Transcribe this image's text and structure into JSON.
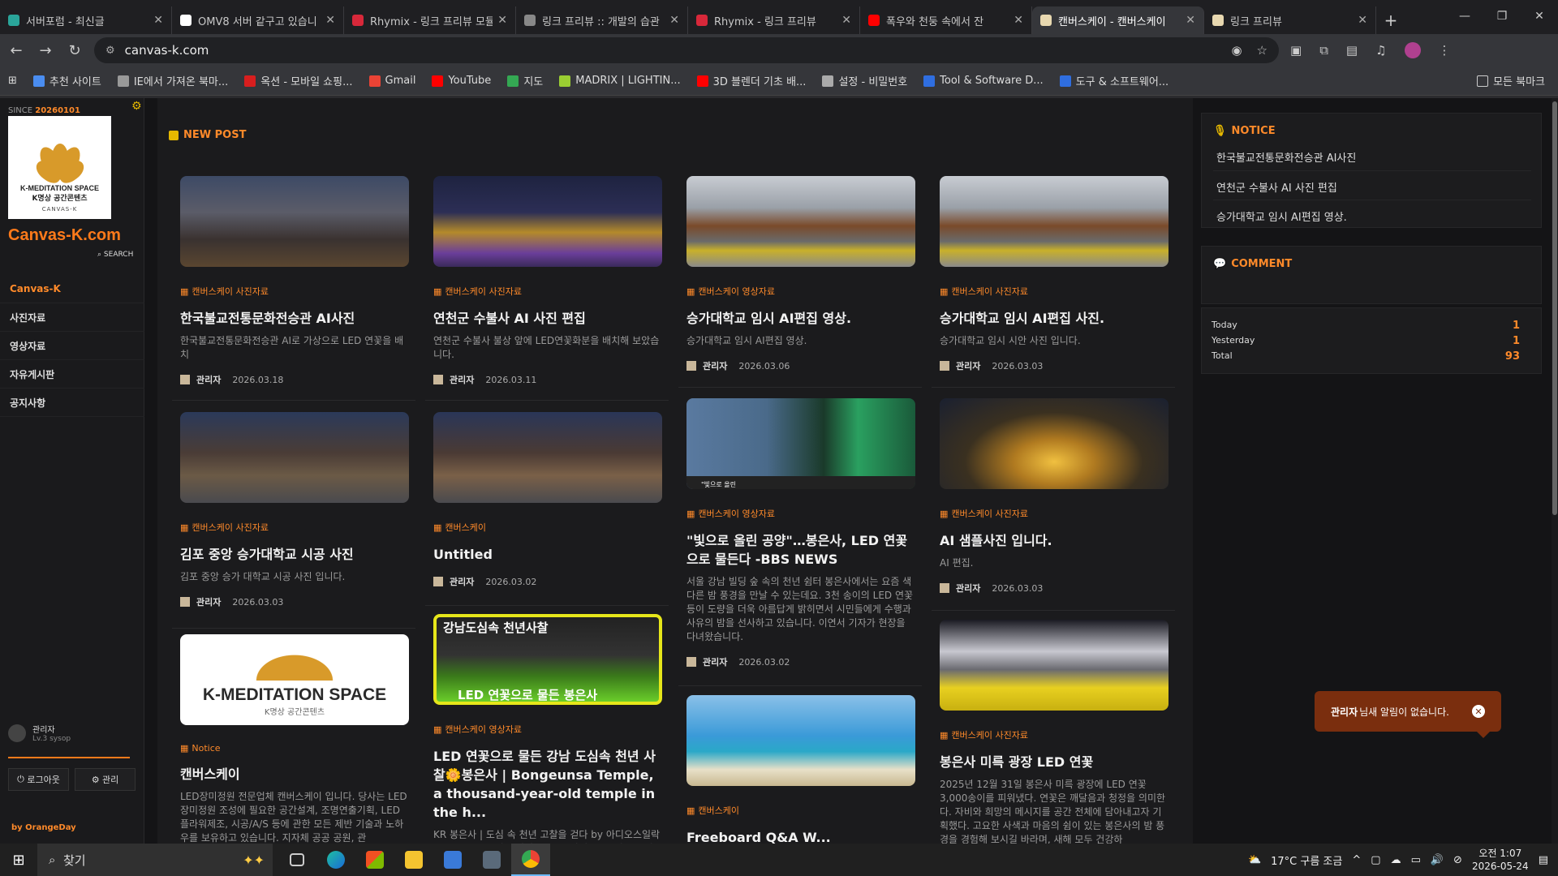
{
  "browser": {
    "tabs": [
      {
        "title": "서버포럼 - 최신글",
        "color": "#2aa59a",
        "active": false
      },
      {
        "title": "OMV8 서버 같구고 있습니",
        "color": "#ffffff",
        "active": false
      },
      {
        "title": "Rhymix - 링크 프리뷰 모듈",
        "color": "#d8283a",
        "active": false
      },
      {
        "title": "링크 프리뷰 :: 개발의 습관",
        "color": "#888888",
        "active": false
      },
      {
        "title": "Rhymix - 링크 프리뷰",
        "color": "#d8283a",
        "active": false
      },
      {
        "title": "폭우와 천둥 속에서 잔",
        "color": "#ff0000",
        "active": false
      },
      {
        "title": "캔버스케이 - 캔버스케이",
        "color": "#e8d8b0",
        "active": true
      },
      {
        "title": "링크 프리뷰",
        "color": "#e8d8b0",
        "active": false
      }
    ],
    "url": "canvas-k.com",
    "bookmarks": [
      {
        "label": "추천 사이트",
        "color": "#4a8df0"
      },
      {
        "label": "IE에서 가져온 북마...",
        "color": "#999999"
      },
      {
        "label": "옥션 - 모바일 쇼핑...",
        "color": "#d81e1e"
      },
      {
        "label": "Gmail",
        "color": "#ea4335"
      },
      {
        "label": "YouTube",
        "color": "#ff0000"
      },
      {
        "label": "지도",
        "color": "#34a853"
      },
      {
        "label": "MADRIX | LIGHTIN...",
        "color": "#9acd32"
      },
      {
        "label": "3D 블렌더 기초 배...",
        "color": "#ff0000"
      },
      {
        "label": "설정 - 비밀번호",
        "color": "#aaaaaa"
      },
      {
        "label": "Tool & Software D...",
        "color": "#2f6ee0"
      },
      {
        "label": "도구 & 소프트웨어...",
        "color": "#2f6ee0"
      }
    ],
    "all_bookmarks": "모든 북마크"
  },
  "sidebar": {
    "since_label": "SINCE",
    "since_date": "20260101",
    "logo_line1": "K-MEDITATION SPACE",
    "logo_line2": "K명상 공간콘텐츠",
    "logo_line3": "CANVAS-K",
    "site_name": "Canvas-K.com",
    "search_label": "SEARCH",
    "menu": [
      "Canvas-K",
      "사진자료",
      "영상자료",
      "자유게시판",
      "공지사항"
    ],
    "user_name": "관리자",
    "user_level": "Lv.3",
    "user_id": "sysop",
    "logout_label": "로그아웃",
    "admin_label": "관리",
    "credit": "by OrangeDay"
  },
  "main": {
    "new_post_label": "NEW POST",
    "posts": [
      {
        "category": "캔버스케이 사진자료",
        "title": "한국불교전통문화전승관 AI사진",
        "desc": "한국불교전통문화전승관 AI로 가상으로 LED 연꽃을 배치",
        "author": "관리자",
        "date": "2026.03.18"
      },
      {
        "category": "캔버스케이 사진자료",
        "title": "연천군 수불사 AI 사진 편집",
        "desc": "연천군 수불사 불상 앞에 LED연꽃화분을 배치해 보았습니다.",
        "author": "관리자",
        "date": "2026.03.11"
      },
      {
        "category": "캔버스케이 영상자료",
        "title": "승가대학교 임시 AI편집 영상.",
        "desc": "승가대학교 임시 AI편집 영상.",
        "author": "관리자",
        "date": "2026.03.06"
      },
      {
        "category": "캔버스케이 사진자료",
        "title": "승가대학교 임시 AI편집 사진.",
        "desc": "승가대학교 임시 시안 사진 입니다.",
        "author": "관리자",
        "date": "2026.03.03"
      },
      {
        "category": "캔버스케이 사진자료",
        "title": "김포 중앙 승가대학교 시공 사진",
        "desc": "김포 중앙 승가 대학교 시공 사진 입니다.",
        "author": "관리자",
        "date": "2026.03.03"
      },
      {
        "category": "캔버스케이",
        "title": "Untitled",
        "desc": "",
        "author": "관리자",
        "date": "2026.03.02"
      },
      {
        "category": "캔버스케이 영상자료",
        "title": "\"빛으로 올린 공양\"…봉은사, LED 연꽃으로 물든다 -BBS NEWS",
        "desc": "서울 강남 빌딩 숲 속의 천년 쉼터 봉은사에서는 요즘 색다른 밤 풍경을 만날 수 있는데요. 3천 송이의 LED 연꽃등이 도량을 더욱 아름답게 밝히면서 시민들에게 수행과 사유의 밤을 선사하고 있습니다. 이연서 기자가 현장을 다녀왔습니다.",
        "author": "관리자",
        "date": "2026.03.02"
      },
      {
        "category": "캔버스케이 사진자료",
        "title": "AI 샘플사진 입니다.",
        "desc": "AI 편집.",
        "author": "관리자",
        "date": "2026.03.03"
      },
      {
        "category": "Notice",
        "title": "캔버스케이",
        "desc": "LED장미정원 전문업체 캔버스케이 입니다. 당사는 LED장미정원 조성에 필요한 공간설계, 조명연출기획, LED플라워제조, 시공/A/S 등에 관한 모든 제반 기술과 노하우를 보유하고 있습니다. 지자체 공공 공원, 관",
        "author": "",
        "date": ""
      },
      {
        "category": "캔버스케이 영상자료",
        "title": "LED 연꽃으로 물든 강남 도심속 천년 사찰🌼봉은사 | Bongeunsa Temple, a thousand-year-old temple in the h...",
        "desc": "KR 봉은사 | 도심 속 천년 고찰을 걷다 by 아디오스일락 (Adios Ilrak) 서울 강남 한복판, 삼성중앙역과 봉은사역 사이에 위치한 봉은사는 천 년의 역사를 간직",
        "author": "",
        "date": ""
      },
      {
        "category": "캔버스케이",
        "title": "Freeboard Q&A W...",
        "desc": "",
        "author": "",
        "date": ""
      },
      {
        "category": "캔버스케이 사진자료",
        "title": "봉은사 미륵 광장 LED 연꽃",
        "desc": "2025년 12월 31일 봉은사 미륵 광장에 LED 연꽃 3,000송이를 피워냈다. 연꽃은 깨달음과 청정을 의미한다. 자비와 희망의 메시지를 공간 전체에 담아내고자 기획했다. 고요한 사색과 마음의 쉼이 있는 봉은사의 밤 풍경을 경험해 보시길 바라며, 새해 모두 건강하",
        "author": "",
        "date": ""
      }
    ],
    "thumb_banner_text": "강남도심속 천년사찰",
    "thumb_banner_text2": "LED 연꽃으로 물든 봉은사",
    "thumb_logo_text": "K-MEDITATION SPACE",
    "thumb_logo_sub": "K명상 공간콘텐츠",
    "thumb_bbs": "\"빛으로 올린"
  },
  "right": {
    "notice_label": "NOTICE",
    "notices": [
      "한국불교전통문화전승관 AI사진",
      "연천군 수불사 AI 사진 편집",
      "승가대학교 임시 AI편집 영상."
    ],
    "comment_label": "COMMENT",
    "stats": [
      {
        "label": "Today",
        "value": "1"
      },
      {
        "label": "Yesterday",
        "value": "1"
      },
      {
        "label": "Total",
        "value": "93"
      }
    ]
  },
  "toast": {
    "user": "관리자",
    "message": "님새 알림이 없습니다."
  },
  "taskbar": {
    "search_placeholder": "찾기",
    "weather": "17°C 구름 조금",
    "time": "오전 1:07",
    "date": "2026-05-24"
  }
}
